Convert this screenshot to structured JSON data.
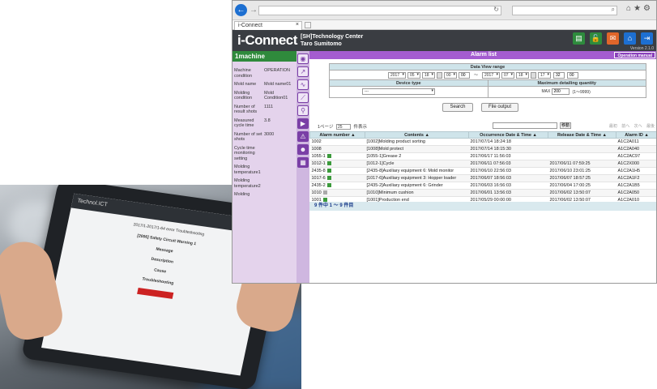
{
  "tab": {
    "title": "i-Connect"
  },
  "app": {
    "logo": "i-Connect",
    "user_line1": "[SH]Technology Center",
    "user_line2": "Taro Sumitomo",
    "version": "Version 2.1.0"
  },
  "left_panel": {
    "title": "1machine",
    "rows": [
      {
        "key": "Machine condition",
        "value": "OPERATION"
      },
      {
        "key": "Mold name",
        "value": "Mold name01"
      },
      {
        "key": "Molding condition",
        "value": "Mold Condition01"
      },
      {
        "key": "Number of result shots",
        "value": "1111"
      },
      {
        "key": "Measured cycle time",
        "value": "3.8"
      },
      {
        "key": "Number of set shots",
        "value": "3000"
      },
      {
        "key": "Cycle time monitoring setting",
        "value": ""
      },
      {
        "key": "Molding temperature1",
        "value": ""
      },
      {
        "key": "Molding temperature2",
        "value": ""
      },
      {
        "key": "Molding",
        "value": ""
      }
    ]
  },
  "main": {
    "title": "Alarm list",
    "operation_manual": "Operation manual",
    "filter": {
      "data_view_range": "Data View range",
      "from": {
        "year": "2017",
        "month": "05",
        "day": "18",
        "hour": "00",
        "minute": "00"
      },
      "to": {
        "year": "2017",
        "month": "07",
        "day": "18",
        "hour": "17",
        "minute": "32",
        "second": "00"
      },
      "range_sep": "〜",
      "device_type_label": "Device type",
      "device_type_value": "---",
      "max_qty_label": "Maximum detailing quantity",
      "max_label": "MAX",
      "max_value": "200",
      "max_range": "(1〜9999)"
    },
    "buttons": {
      "search": "Search",
      "file_output": "File output"
    },
    "pager_top": {
      "prefix": "1ページ",
      "page_size": "25",
      "suffix": "件表示",
      "jump": "移動",
      "nav": "最初 前へ 次へ 最後"
    },
    "columns": [
      "Alarm number ▲",
      "Contents ▲",
      "Occurrence Date & Time ▲",
      "Release Date & Time ▲",
      "Alarm ID ▲"
    ],
    "rows": [
      {
        "num": "1002",
        "mark": "",
        "content": "[1002]Molding product sorting",
        "occ": "2017/07/14 18:24:18",
        "rel": "",
        "id": "A1C2A011"
      },
      {
        "num": "1008",
        "mark": "",
        "content": "[1008]Mold protect",
        "occ": "2017/07/14 18:15:30",
        "rel": "",
        "id": "A1C2A040"
      },
      {
        "num": "1055-1",
        "mark": "green",
        "content": "[1055-1]Grease 2",
        "occ": "2017/06/17 11:56:03",
        "rel": "",
        "id": "A1C2AC97"
      },
      {
        "num": "1012-1",
        "mark": "green",
        "content": "[1012-1]Cycle",
        "occ": "2017/06/11 07:56:03",
        "rel": "2017/06/11 07:59:25",
        "id": "A1C2X000"
      },
      {
        "num": "2435-8",
        "mark": "green",
        "content": "[2435-8]Auxiliary equipment 6: Mold monitor",
        "occ": "2017/06/10 22:56:03",
        "rel": "2017/06/10 23:01:25",
        "id": "A1C2A1H5"
      },
      {
        "num": "1017-6",
        "mark": "green",
        "content": "[1017-6]Auxiliary equipment 3: Hopper loader",
        "occ": "2017/06/07 18:56:03",
        "rel": "2017/06/07 18:57:25",
        "id": "A1C2A1F2"
      },
      {
        "num": "2435-2",
        "mark": "green",
        "content": "[2435-2]Auxiliary equipment 6: Grinder",
        "occ": "2017/06/03 16:56:03",
        "rel": "2017/06/04 17:00:25",
        "id": "A1C2A1B5"
      },
      {
        "num": "1010",
        "mark": "gray",
        "content": "[1010]Minimum cushion",
        "occ": "2017/06/01 13:56:03",
        "rel": "2017/06/02 13:50:07",
        "id": "A1C2A050"
      },
      {
        "num": "1001",
        "mark": "green",
        "content": "[1001]Production end",
        "occ": "2017/05/29 00:00:00",
        "rel": "2017/06/02 13:50:07",
        "id": "A1C2A010"
      }
    ],
    "pager_bottom": "9 件中 1 〜 9 件目"
  },
  "tablet_screen": {
    "bar": "Technol.ICT",
    "lines": [
      "2017/1-2017/1-64 error Troubleshooting",
      "[2006] Safety Circuit Warning 1",
      "Message",
      "Description",
      "Cause",
      "Troubleshooting"
    ]
  },
  "colors": {
    "accent_purple": "#a45cd0",
    "machine_green": "#2f8a3c",
    "table_header": "#cfe4ea"
  }
}
